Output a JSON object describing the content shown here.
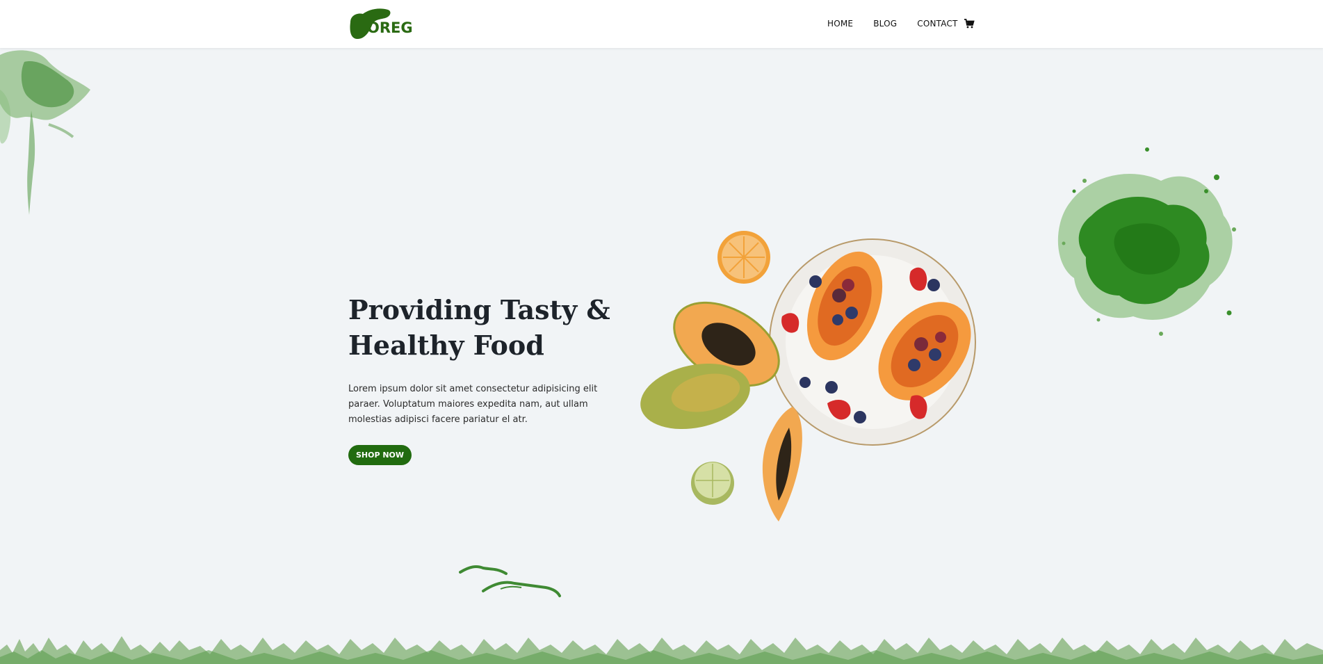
{
  "brand": {
    "logo_text": "OREG",
    "color": "#216b0f"
  },
  "nav": {
    "items": [
      "HOME",
      "BLOG",
      "CONTACT"
    ],
    "cart_icon": "cart-icon"
  },
  "hero": {
    "title_line1": "Providing Tasty &",
    "title_line2": "Healthy Food",
    "description": "Lorem ipsum dolor sit amet consectetur adipisicing elit paraer. Voluptatum maiores expedita nam, aut ullam molestias adipisci facere pariatur el atr.",
    "button_label": "SHOP NOW"
  },
  "colors": {
    "background": "#f1f4f6",
    "accent": "#216b0f",
    "splash": "#3a8a2a",
    "heading": "#1d232a"
  }
}
